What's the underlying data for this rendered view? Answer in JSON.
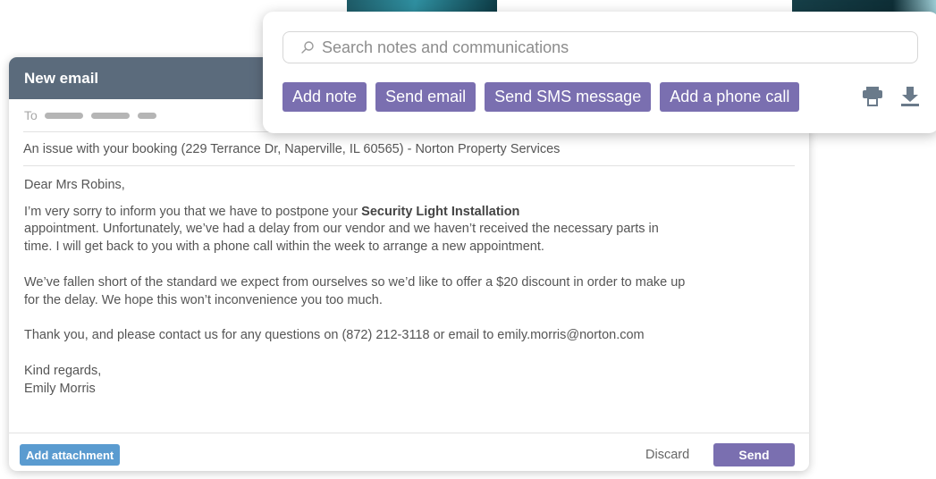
{
  "email": {
    "title": "New email",
    "to_label": "To",
    "subject": "An issue with your booking (229 Terrance Dr, Naperville, IL 60565) - Norton Property Services",
    "greeting": "Dear Mrs Robins,",
    "p1_pre": "I’m very sorry to inform you that we have to postpone your ",
    "p1_bold": "Security Light Installation",
    "p1_line2": "appointment. Unfortunately, we’ve had a delay from our vendor and we haven’t received the necessary parts in",
    "p1_line3": "time. I will get back to you with a phone call within the week to arrange a new appointment.",
    "p2_line1": "We’ve fallen short of the standard we expect from ourselves so we’d like to offer a $20 discount in order to make up",
    "p2_line2": "for the delay. We hope this won’t inconvenience you too much.",
    "p3": "Thank you, and please contact us for any questions on (872) 212-3118 or email to emily.morris@norton.com",
    "signoff": "Kind regards,",
    "signature": "Emily Morris",
    "attach_label": "Add attachment",
    "discard_label": "Discard",
    "send_label": "Send"
  },
  "toolbar": {
    "search_placeholder": "Search notes and communications",
    "actions": [
      "Add note",
      "Send email",
      "Send SMS message",
      "Add a phone call"
    ],
    "icons": [
      "search-icon",
      "print-icon",
      "download-icon"
    ]
  },
  "colors": {
    "header": "#5b6b7c",
    "accent_purple": "#7a6fb0",
    "attach_blue": "#5a9bd0"
  }
}
